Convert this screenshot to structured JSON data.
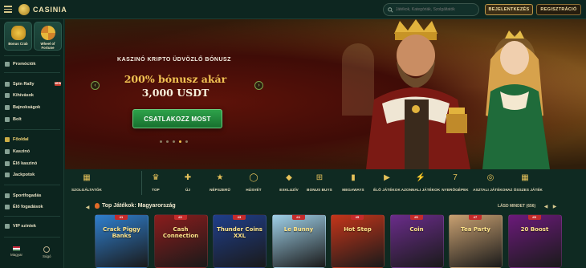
{
  "brand": {
    "name": "CASINIA"
  },
  "header": {
    "search_placeholder": "Játékok, Kategóriák, Szolgáltatók",
    "login_label": "BEJELENTKEZÉS",
    "register_label": "REGISZTRÁCIÓ"
  },
  "sidebar": {
    "tiles": [
      {
        "label": "Bonus Crab",
        "icon": "crab-icon"
      },
      {
        "label": "Wheel of Fortune",
        "icon": "wheel-icon"
      }
    ],
    "items": [
      {
        "label": "Promóciók",
        "icon": "gift-icon"
      },
      {
        "label": "Spin Rally",
        "icon": "flag-icon",
        "badge": "NEW"
      },
      {
        "label": "Kihívások",
        "icon": "target-icon"
      },
      {
        "label": "Bajnokságok",
        "icon": "trophy-icon"
      },
      {
        "label": "Bolt",
        "icon": "shop-icon"
      },
      {
        "label": "Főoldal",
        "icon": "home-icon",
        "active": true
      },
      {
        "label": "Kaszinó",
        "icon": "cards-icon"
      },
      {
        "label": "Élő kaszinó",
        "icon": "live-icon"
      },
      {
        "label": "Jackpotok",
        "icon": "jackpot-icon"
      },
      {
        "label": "Sportfogadás",
        "icon": "ball-icon"
      },
      {
        "label": "Élő fogadások",
        "icon": "live-bet-icon"
      },
      {
        "label": "VIP szintek",
        "icon": "crown-icon"
      }
    ],
    "footer": {
      "language": "Magyar",
      "help": "Súgó"
    }
  },
  "hero": {
    "kicker": "KASZINÓ KRIPTO ÜDVÖZLŐ BÓNUSZ",
    "title": "200% bónusz akár",
    "title2": "3,000 USDT",
    "cta": "CSATLAKOZZ MOST",
    "slides": 5,
    "active_slide": 4
  },
  "categories": [
    {
      "label": "SZOLGÁLTATÓK",
      "icon": "providers-icon"
    },
    {
      "label": "TOP",
      "icon": "crown-icon"
    },
    {
      "label": "ÚJ",
      "icon": "new-icon"
    },
    {
      "label": "NÉPSZERŰ",
      "icon": "popular-icon"
    },
    {
      "label": "HÚSVÉT",
      "icon": "egg-icon"
    },
    {
      "label": "EXKLUZÍV",
      "icon": "diamond-icon"
    },
    {
      "label": "BONUS BUYS",
      "icon": "bonus-buy-icon"
    },
    {
      "label": "MEGAWAYS",
      "icon": "megaways-icon"
    },
    {
      "label": "ÉLŐ JÁTÉKOK",
      "icon": "live-games-icon"
    },
    {
      "label": "AZONNALI JÁTÉKOK",
      "icon": "instant-icon"
    },
    {
      "label": "NYERŐGÉPEK",
      "icon": "slot-icon"
    },
    {
      "label": "ASZTALI JÁTÉKOK",
      "icon": "table-icon"
    },
    {
      "label": "AZ ÖSSZES JÁTÉK",
      "icon": "all-games-icon"
    }
  ],
  "games": {
    "title": "Top Játékok: Magyarország",
    "see_all": "LÁSD MINDET (656)",
    "cards": [
      {
        "name": "Crack Piggy Banks",
        "badge": "#1",
        "bg": "#2f7fce"
      },
      {
        "name": "Cash Connection",
        "badge": "#2",
        "bg": "#8a1c1c"
      },
      {
        "name": "Thunder Coins XXL",
        "badge": "#3",
        "bg": "#1f3e8a"
      },
      {
        "name": "Le Bunny",
        "badge": "#4",
        "bg": "#9fd0e8"
      },
      {
        "name": "Hot Step",
        "badge": "#5",
        "bg": "#c4351a"
      },
      {
        "name": "Coin",
        "badge": "#6",
        "bg": "#6a2c8a"
      },
      {
        "name": "Tea Party",
        "badge": "#7",
        "bg": "#c8a071"
      },
      {
        "name": "20 Boost",
        "badge": "#8",
        "bg": "#6b1a7a"
      }
    ]
  }
}
